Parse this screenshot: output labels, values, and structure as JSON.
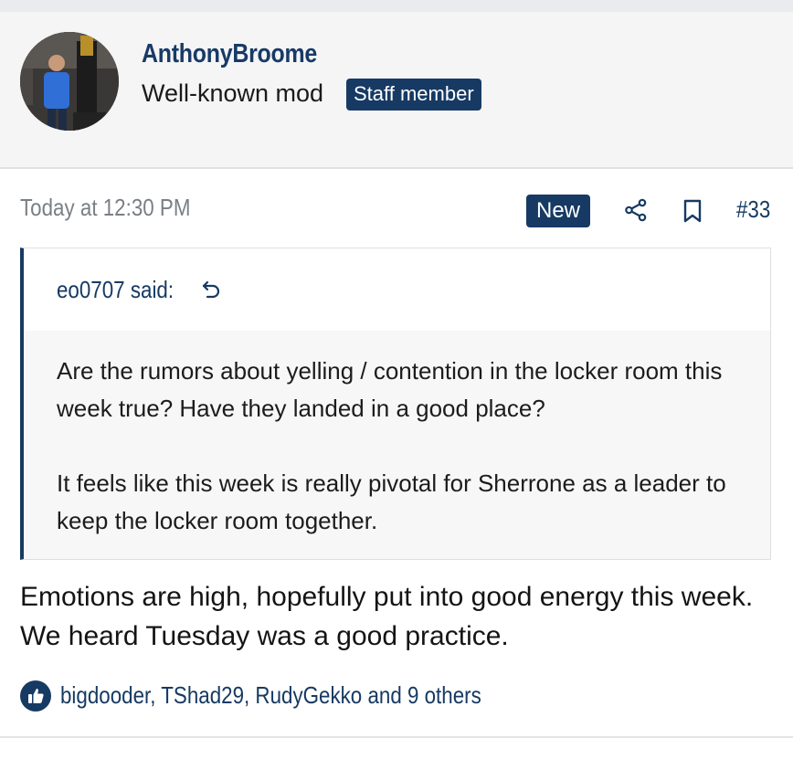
{
  "user": {
    "name": "AnthonyBroome",
    "title": "Well-known mod",
    "badge": "Staff member",
    "avatar_icon": "user-photo-avatar"
  },
  "post": {
    "date": "Today at 12:30 PM",
    "new_badge": "New",
    "share_icon": "share-icon",
    "bookmark_icon": "bookmark-icon",
    "number": "#33"
  },
  "quote": {
    "author": "eo0707 said:",
    "jump_icon": "jump-to-quote-icon",
    "paragraphs": [
      "Are the rumors about yelling / contention in the locker room this week true? Have they landed in a good place?",
      "It feels like this week is really pivotal for Sherrone as a leader to keep the locker room together."
    ]
  },
  "reply": {
    "text": "Emotions are high, hopefully put into good energy this week. We heard Tuesday was a good practice."
  },
  "reactions": {
    "icon": "like-icon",
    "text": "bigdooder, TShad29, RudyGekko and 9 others"
  },
  "colors": {
    "accent": "#163a63",
    "muted": "#7a7f85",
    "header_bg": "#f5f5f6",
    "quote_bg": "#f7f7f8"
  }
}
